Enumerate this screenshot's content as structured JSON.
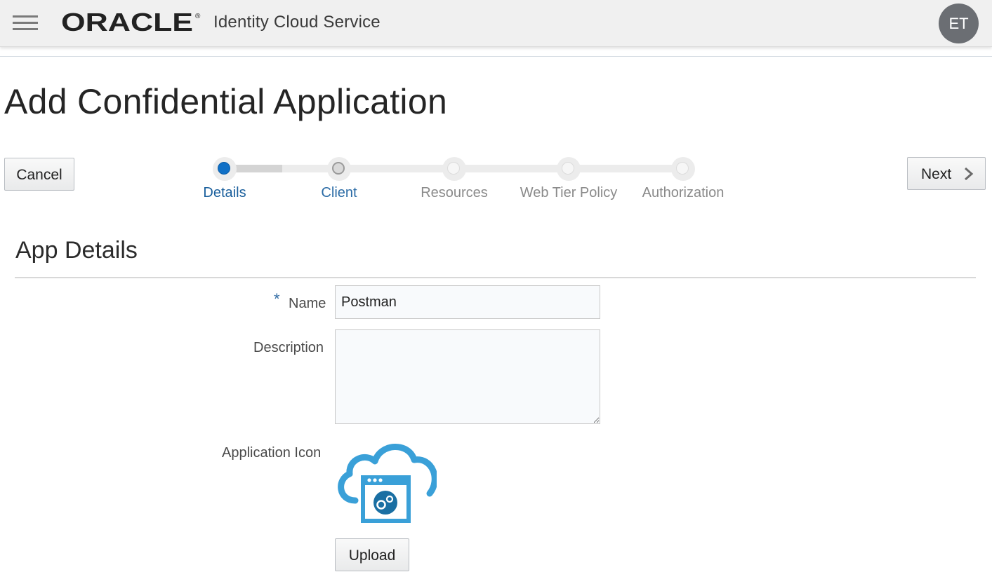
{
  "header": {
    "menu_icon": "hamburger-menu-icon",
    "brand": "ORACLE",
    "brand_mark": "®",
    "product": "Identity Cloud Service",
    "user_initials": "ET"
  },
  "page": {
    "title": "Add Confidential Application"
  },
  "actions": {
    "cancel_label": "Cancel",
    "next_label": "Next",
    "next_icon": "chevron-right-icon"
  },
  "train": {
    "steps": [
      {
        "label": "Details",
        "state": "active"
      },
      {
        "label": "Client",
        "state": "visited"
      },
      {
        "label": "Resources",
        "state": "unvisited"
      },
      {
        "label": "Web Tier Policy",
        "state": "unvisited"
      },
      {
        "label": "Authorization",
        "state": "unvisited"
      }
    ]
  },
  "section": {
    "title": "App Details"
  },
  "form": {
    "required_marker": "*",
    "name_label": "Name",
    "name_value": "Postman",
    "description_label": "Description",
    "description_value": "",
    "icon_label": "Application Icon",
    "app_icon": "cloud-application-icon",
    "upload_label": "Upload"
  },
  "colors": {
    "accent": "#1070c6",
    "icon_blue": "#3aa0d8",
    "icon_dark": "#1a6fa3",
    "header_bg": "#f0f0f0",
    "avatar_bg": "#6b6e73"
  }
}
